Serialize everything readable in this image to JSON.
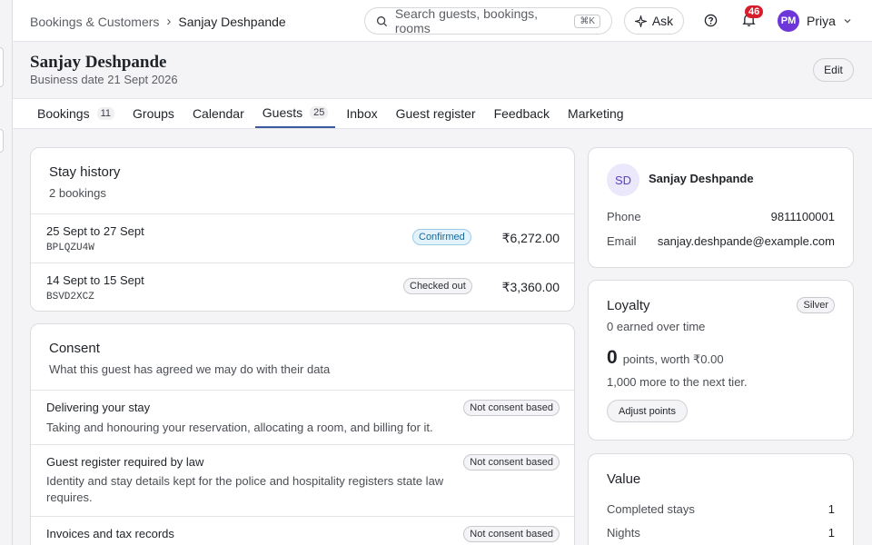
{
  "breadcrumb": {
    "parent": "Bookings & Customers",
    "current": "Sanjay Deshpande"
  },
  "search": {
    "placeholder": "Search guests, bookings, rooms",
    "shortcut": "⌘K"
  },
  "ask_label": "Ask",
  "notifications": {
    "count": "46"
  },
  "user": {
    "initials": "PM",
    "name": "Priya"
  },
  "guest": {
    "name": "Sanjay Deshpande",
    "business_date": "Business date 21 Sept 2026",
    "edit_label": "Edit"
  },
  "tabs": [
    {
      "label": "Bookings",
      "count": "11"
    },
    {
      "label": "Groups"
    },
    {
      "label": "Calendar"
    },
    {
      "label": "Guests",
      "count": "25"
    },
    {
      "label": "Inbox"
    },
    {
      "label": "Guest register"
    },
    {
      "label": "Feedback"
    },
    {
      "label": "Marketing"
    }
  ],
  "stay_history": {
    "title": "Stay history",
    "subtitle": "2 bookings",
    "bookings": [
      {
        "dates": "25 Sept to 27 Sept",
        "code": "BPLQZU4W",
        "status": "Confirmed",
        "amount": "₹6,272.00"
      },
      {
        "dates": "14 Sept to 15 Sept",
        "code": "BSVD2XCZ",
        "status": "Checked out",
        "amount": "₹3,360.00"
      }
    ]
  },
  "consent": {
    "title": "Consent",
    "subtitle": "What this guest has agreed we may do with their data",
    "items": [
      {
        "title": "Delivering your stay",
        "desc": "Taking and honouring your reservation, allocating a room, and billing for it.",
        "badge": "Not consent based"
      },
      {
        "title": "Guest register required by law",
        "desc": "Identity and stay details kept for the police and hospitality registers state law requires.",
        "badge": "Not consent based"
      },
      {
        "title": "Invoices and tax records",
        "desc": "",
        "badge": "Not consent based"
      }
    ]
  },
  "profile": {
    "initials": "SD",
    "name": "Sanjay Deshpande",
    "phone_label": "Phone",
    "phone": "9811100001",
    "email_label": "Email",
    "email": "sanjay.deshpande@example.com"
  },
  "loyalty": {
    "title": "Loyalty",
    "tier": "Silver",
    "earned": "0 earned over time",
    "points": "0",
    "points_text": "points, worth ₹0.00",
    "next_tier": "1,000 more to the next tier.",
    "adjust_label": "Adjust points"
  },
  "value": {
    "title": "Value",
    "rows": [
      {
        "label": "Completed stays",
        "value": "1"
      },
      {
        "label": "Nights",
        "value": "1"
      }
    ]
  }
}
